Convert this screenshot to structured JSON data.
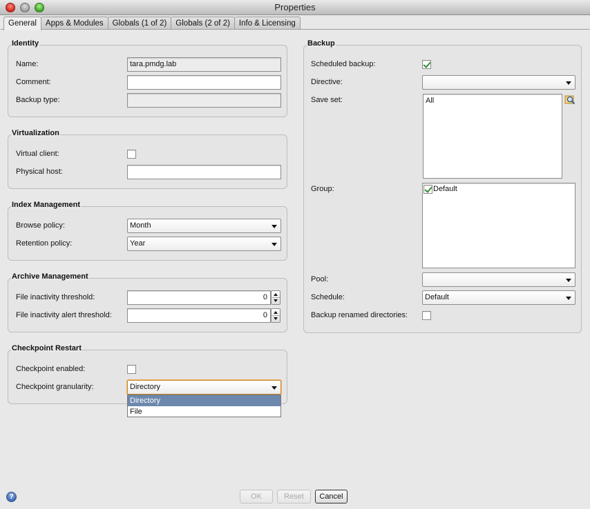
{
  "window": {
    "title": "Properties"
  },
  "tabs": [
    {
      "label": "General",
      "active": true
    },
    {
      "label": "Apps & Modules"
    },
    {
      "label": "Globals (1 of 2)"
    },
    {
      "label": "Globals (2 of 2)"
    },
    {
      "label": "Info & Licensing"
    }
  ],
  "identity": {
    "title": "Identity",
    "name_label": "Name:",
    "name_value": "tara.pmdg.lab",
    "comment_label": "Comment:",
    "comment_value": "",
    "backup_type_label": "Backup type:",
    "backup_type_value": ""
  },
  "virtualization": {
    "title": "Virtualization",
    "virtual_client_label": "Virtual client:",
    "virtual_client_checked": false,
    "physical_host_label": "Physical host:",
    "physical_host_value": ""
  },
  "index_management": {
    "title": "Index Management",
    "browse_policy_label": "Browse policy:",
    "browse_policy_value": "Month",
    "retention_policy_label": "Retention policy:",
    "retention_policy_value": "Year"
  },
  "archive_management": {
    "title": "Archive Management",
    "inactivity_threshold_label": "File inactivity threshold:",
    "inactivity_threshold_value": "0",
    "inactivity_alert_label": "File inactivity alert threshold:",
    "inactivity_alert_value": "0"
  },
  "checkpoint": {
    "title": "Checkpoint Restart",
    "enabled_label": "Checkpoint enabled:",
    "enabled_checked": false,
    "granularity_label": "Checkpoint granularity:",
    "granularity_value": "Directory",
    "granularity_options": [
      "Directory",
      "File"
    ]
  },
  "backup": {
    "title": "Backup",
    "scheduled_label": "Scheduled backup:",
    "scheduled_checked": true,
    "directive_label": "Directive:",
    "directive_value": "",
    "save_set_label": "Save set:",
    "save_set_items": [
      "All"
    ],
    "group_label": "Group:",
    "group_items": [
      {
        "label": "Default",
        "checked": true
      }
    ],
    "pool_label": "Pool:",
    "pool_value": "",
    "schedule_label": "Schedule:",
    "schedule_value": "Default",
    "renamed_dirs_label": "Backup renamed directories:",
    "renamed_dirs_checked": false
  },
  "buttons": {
    "ok": "OK",
    "reset": "Reset",
    "cancel": "Cancel",
    "help": "?"
  },
  "colors": {
    "selection": "#6d88ad",
    "check": "#2f8a2f"
  },
  "icons": {
    "lookup": "magnifier-icon",
    "help": "help-icon"
  }
}
